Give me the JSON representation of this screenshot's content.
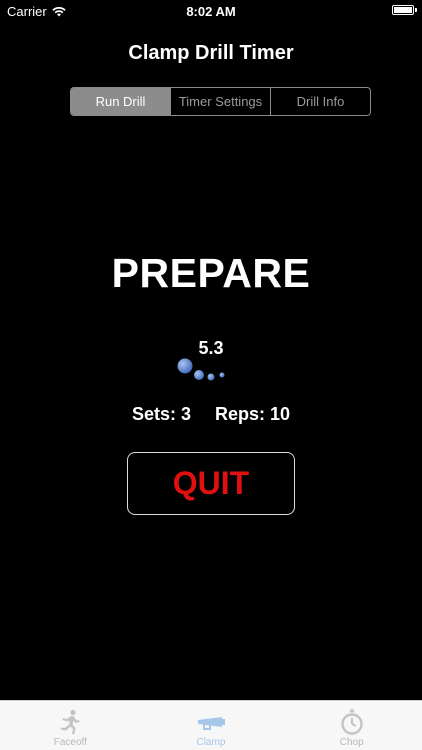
{
  "status_bar": {
    "carrier": "Carrier",
    "time": "8:02 AM",
    "battery_level": 1.0
  },
  "header": {
    "title": "Clamp Drill Timer"
  },
  "segmented_control": {
    "segments": [
      "Run Drill",
      "Timer Settings",
      "Drill Info"
    ],
    "selected": "Run Drill"
  },
  "drill": {
    "phase": "PREPARE",
    "countdown": "5.3",
    "sets": "Sets: 3",
    "reps": "Reps: 10",
    "quit_label": "QUIT"
  },
  "tab_bar": {
    "tabs": [
      {
        "label": "Faceoff",
        "icon": "runner-icon"
      },
      {
        "label": "Clamp",
        "icon": "clamp-icon"
      },
      {
        "label": "Chop",
        "icon": "stopwatch-icon"
      }
    ],
    "active": "Clamp"
  },
  "colors": {
    "background": "#000000",
    "quit_text": "#e01010",
    "spinner_blue": "#4a78c8",
    "tab_active": "#a6c6ea"
  }
}
